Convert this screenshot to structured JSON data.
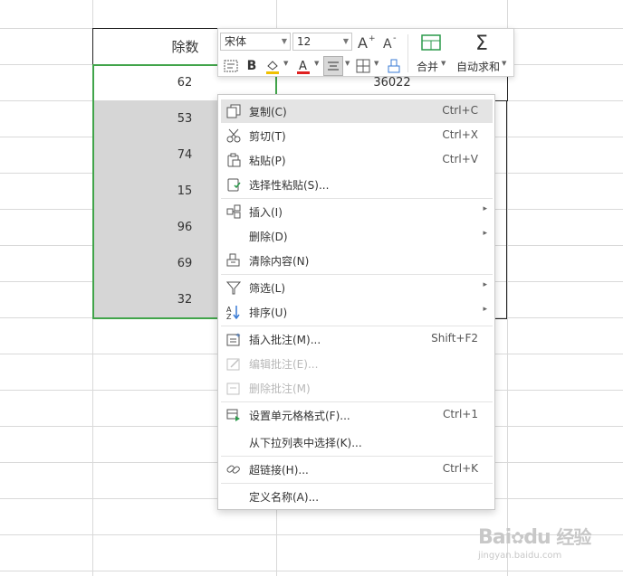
{
  "table": {
    "header": "除数",
    "values": [
      "62",
      "53",
      "74",
      "15",
      "96",
      "69",
      "32"
    ],
    "right_first_value": "36022"
  },
  "toolbar": {
    "font_name": "宋体",
    "font_size": "12",
    "merge_label": "合并",
    "autosum_label": "自动求和"
  },
  "menu": {
    "copy": {
      "label": "复制(C)",
      "shortcut": "Ctrl+C"
    },
    "cut": {
      "label": "剪切(T)",
      "shortcut": "Ctrl+X"
    },
    "paste": {
      "label": "粘贴(P)",
      "shortcut": "Ctrl+V"
    },
    "paste_special": {
      "label": "选择性粘贴(S)..."
    },
    "insert": {
      "label": "插入(I)"
    },
    "delete": {
      "label": "删除(D)"
    },
    "clear": {
      "label": "清除内容(N)"
    },
    "filter": {
      "label": "筛选(L)"
    },
    "sort": {
      "label": "排序(U)"
    },
    "insert_comment": {
      "label": "插入批注(M)...",
      "shortcut": "Shift+F2"
    },
    "edit_comment": {
      "label": "编辑批注(E)..."
    },
    "delete_comment": {
      "label": "删除批注(M)"
    },
    "format_cells": {
      "label": "设置单元格格式(F)...",
      "shortcut": "Ctrl+1"
    },
    "pick_list": {
      "label": "从下拉列表中选择(K)..."
    },
    "hyperlink": {
      "label": "超链接(H)...",
      "shortcut": "Ctrl+K"
    },
    "define_name": {
      "label": "定义名称(A)..."
    }
  },
  "watermark": {
    "brand": "Bai",
    "brand2": "du",
    "cn": "经验",
    "url": "jingyan.baidu.com"
  },
  "colors": {
    "selection_border": "#41a44a",
    "font_color_bar": "#e02020",
    "fill_color_bar": "#f0c000"
  }
}
